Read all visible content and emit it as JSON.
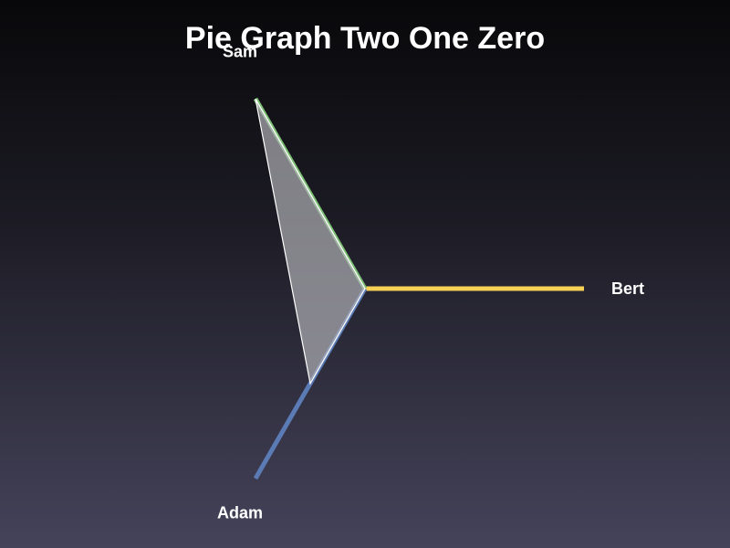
{
  "chart_data": {
    "type": "radar",
    "title": "Pie Graph Two One Zero",
    "axes": [
      "Bert",
      "Adam",
      "Sam"
    ],
    "axis_colors": [
      "#f7d154",
      "#5b7bb5",
      "#7cbf74"
    ],
    "series": [
      {
        "values": [
          0,
          1,
          2
        ]
      }
    ],
    "rmax": 2,
    "fill_color": "#b4b4b9",
    "fill_opacity": 0.68,
    "stroke_color": "#ffffff"
  }
}
